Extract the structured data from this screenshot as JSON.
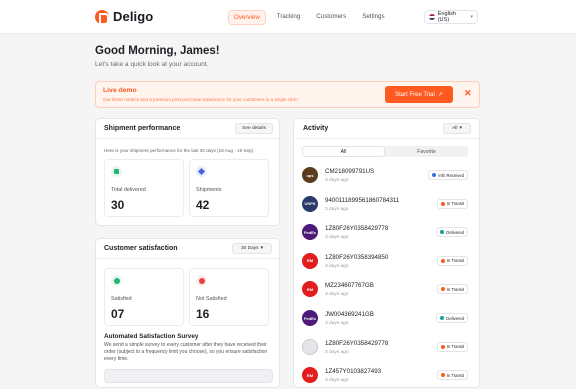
{
  "brand": {
    "name": "Deligo"
  },
  "nav": {
    "items": [
      "Overview",
      "Tracking",
      "Customers",
      "Settings"
    ]
  },
  "language": {
    "label": "English (US)"
  },
  "greeting": {
    "title": "Good Morning, James!",
    "subtitle": "Let's take a quick look at your account."
  },
  "demo": {
    "title": "Live demo",
    "text": "Get these metrics and a premium post-purchase experience for your customers in a single click!",
    "button": "Start Free Trial",
    "close": "✕"
  },
  "shipment": {
    "title": "Shipment performance",
    "details_button": "See details",
    "description": "Here is your shipment performance for the last 30 days (16 Aug - 16 Sep)",
    "stats": [
      {
        "label": "Total delivered",
        "value": "30",
        "icon": "package-icon",
        "color": "#22b573"
      },
      {
        "label": "Shipments",
        "value": "42",
        "icon": "box-icon",
        "color": "#4a63d8"
      }
    ]
  },
  "satisfaction": {
    "title": "Customer satisfaction",
    "period": "30 Days",
    "stats": [
      {
        "label": "Satisfied",
        "value": "07",
        "icon": "smile-icon",
        "color": "#22b573"
      },
      {
        "label": "Not Satisfied",
        "value": "16",
        "icon": "frown-icon",
        "color": "#e5433c"
      }
    ],
    "survey_title": "Automated Satisfaction Survey",
    "survey_text": "We send a simple survey to every customer after they have received their order (subject to a frequency limit you choose), so you ensure satisfaction every time."
  },
  "activity": {
    "title": "Activity",
    "filter": "All",
    "tabs": [
      "All",
      "Favorite"
    ],
    "rows": [
      {
        "carrier": "ups",
        "logo_text": "ups",
        "color": "#5a3b1c",
        "tracking": "CM218099791US",
        "ago": "3 days ago",
        "status": "Info Received",
        "status_color": "#3b6fe0"
      },
      {
        "carrier": "usps",
        "logo_text": "USPS",
        "color": "#2b3a6b",
        "tracking": "9400111899561860784311",
        "ago": "3 days ago",
        "status": "In Transit",
        "status_color": "#ff5a1f"
      },
      {
        "carrier": "fedex",
        "logo_text": "FedEx",
        "color": "#4d1a7a",
        "tracking": "1Z80F26Y0358429778",
        "ago": "3 days ago",
        "status": "Delivered",
        "status_color": "#16a39a"
      },
      {
        "carrier": "royal-mail",
        "logo_text": "RM",
        "color": "#e11d1d",
        "tracking": "1Z80F26Y0358394850",
        "ago": "3 days ago",
        "status": "In Transit",
        "status_color": "#ff5a1f"
      },
      {
        "carrier": "royal-mail",
        "logo_text": "RM",
        "color": "#e11d1d",
        "tracking": "MZ234607767GB",
        "ago": "3 days ago",
        "status": "In Transit",
        "status_color": "#ff5a1f"
      },
      {
        "carrier": "fedex",
        "logo_text": "FedEx",
        "color": "#4d1a7a",
        "tracking": "JW004369241GB",
        "ago": "3 days ago",
        "status": "Delivered",
        "status_color": "#16a39a"
      },
      {
        "carrier": "qr",
        "logo_text": "",
        "color": "#e6e6ea",
        "tracking": "1Z80F26Y0358429778",
        "ago": "3 days ago",
        "status": "In Transit",
        "status_color": "#ff5a1f"
      },
      {
        "carrier": "royal-mail",
        "logo_text": "RM",
        "color": "#e11d1d",
        "tracking": "1Z457Y0103827493",
        "ago": "3 days ago",
        "status": "In Transit",
        "status_color": "#ff5a1f"
      }
    ]
  }
}
